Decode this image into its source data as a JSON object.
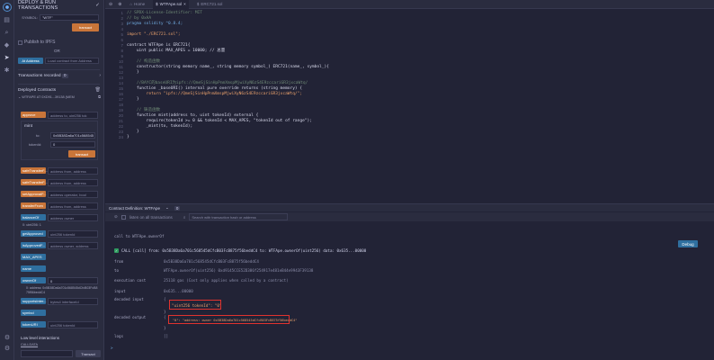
{
  "panel": {
    "title": "DEPLOY & RUN TRANSACTIONS",
    "symbol_label": "SYMBOL:",
    "symbol_value": "\"WTF\"",
    "transact": "transact",
    "publish_ipfs": "Publish to IPFS",
    "or_label": "OR",
    "at_address": "At Address",
    "load_contract_placeholder": "Load contract from Address",
    "transactions_recorded": "Transactions recorded",
    "transactions_count": "0",
    "deployed_contracts": "Deployed Contracts",
    "deployed_item": "WTFAPE AT 0XD91...39138 (MEM",
    "mint_label": "mint",
    "mint_to_label": "to:",
    "mint_to_value": "0x5B38Da6a701c568545",
    "mint_token_label": "tokenId:",
    "mint_token_value": "0",
    "functions": [
      {
        "label": "approve",
        "placeholder": "address to, uint256 tok",
        "color": "orange"
      },
      {
        "label": "safeTransferF...",
        "placeholder": "address from, address",
        "color": "orange"
      },
      {
        "label": "safeTransferF...",
        "placeholder": "address from, address",
        "color": "orange"
      },
      {
        "label": "setApprovalF...",
        "placeholder": "address operator, bool",
        "color": "orange"
      },
      {
        "label": "transferFrom",
        "placeholder": "address from, address",
        "color": "orange"
      },
      {
        "label": "balanceOf",
        "placeholder": "address owner",
        "color": "blue"
      },
      {
        "label": "getApproved",
        "placeholder": "uint256 tokenId",
        "color": "blue"
      },
      {
        "label": "isApprovedF...",
        "placeholder": "address owner, address",
        "color": "blue"
      },
      {
        "label": "MAX_APES",
        "placeholder": "",
        "color": "blue"
      },
      {
        "label": "name",
        "placeholder": "",
        "color": "blue"
      },
      {
        "label": "ownerOf",
        "placeholder": "0",
        "color": "blue"
      },
      {
        "label": "supportsInter...",
        "placeholder": "bytes4 interfaceId",
        "color": "blue"
      },
      {
        "label": "symbol",
        "placeholder": "",
        "color": "blue"
      },
      {
        "label": "tokenURI",
        "placeholder": "uint256 tokenId",
        "color": "blue"
      }
    ],
    "balance_result": "0: uint256: 1",
    "owner_result": "0: address: 0x5B38Da6a701c568545dCfcB03FcB875f56beddC4",
    "low_level": "Low level interactions",
    "calldata_label": "CALLDATA",
    "transact_btn": "Transact"
  },
  "tabs": [
    {
      "label": "Home",
      "active": false
    },
    {
      "label": "WTFApe.sol",
      "active": true
    },
    {
      "label": "ERC721.sol",
      "active": false
    }
  ],
  "code_lines": [
    {
      "n": "1",
      "t": "// SPDX-License-Identifier: MIT",
      "c": "c-com"
    },
    {
      "n": "2",
      "t": "// by 0xAA",
      "c": "c-com"
    },
    {
      "n": "3",
      "t": "pragma solidity ^0.8.4;",
      "c": "c-kw"
    },
    {
      "n": "4",
      "t": "",
      "c": ""
    },
    {
      "n": "5",
      "t": "import \"./ERC721.sol\";",
      "c": "c-str"
    },
    {
      "n": "6",
      "t": "",
      "c": ""
    },
    {
      "n": "7",
      "t": "contract WTFApe is ERC721{",
      "c": ""
    },
    {
      "n": "8",
      "t": "    uint public MAX_APES = 10000; // 总量",
      "c": ""
    },
    {
      "n": "9",
      "t": "",
      "c": ""
    },
    {
      "n": "10",
      "t": "    // 构造函数",
      "c": "c-com"
    },
    {
      "n": "11",
      "t": "    constructor(string memory name_, string memory symbol_) ERC721(name_, symbol_){",
      "c": ""
    },
    {
      "n": "12",
      "t": "    }",
      "c": ""
    },
    {
      "n": "13",
      "t": "",
      "c": ""
    },
    {
      "n": "14",
      "t": "    //BAYC的baseURI为ipfs://QmeSjSinHpPnmXmspMjwiXyN6zS4E9zccariGR3jxcaWtq/",
      "c": "c-com"
    },
    {
      "n": "15",
      "t": "    function _baseURI() internal pure override returns (string memory) {",
      "c": ""
    },
    {
      "n": "16",
      "t": "        return \"ipfs://QmeSjSinHpPnmXmspMjwiXyN6zS4E9zccariGR3jxcaWtq/\";",
      "c": "c-str"
    },
    {
      "n": "17",
      "t": "    }",
      "c": ""
    },
    {
      "n": "18",
      "t": "",
      "c": ""
    },
    {
      "n": "19",
      "t": "    // 铸造函数",
      "c": "c-com"
    },
    {
      "n": "20",
      "t": "    function mint(address to, uint tokenId) external {",
      "c": ""
    },
    {
      "n": "21",
      "t": "        require(tokenId >= 0 && tokenId < MAX_APES, \"tokenId out of range\");",
      "c": ""
    },
    {
      "n": "22",
      "t": "        _mint(to, tokenId);",
      "c": ""
    },
    {
      "n": "23",
      "t": "    }",
      "c": ""
    },
    {
      "n": "24",
      "t": "}",
      "c": ""
    }
  ],
  "terminal": {
    "bar_label": "Contract Definition: WTFApe",
    "listen_count": "0",
    "listen_label": "listen on all transactions",
    "search_placeholder": "Search with transaction hash or address",
    "call_line": "call to WTFApe.ownerOf",
    "call_header": "CALL  [call] from: 0x5B38Da6a701c568545dCfcB03FcB875f56beddC4 to: WTFApe.ownerOf(uint256) data: 0x635...00000",
    "debug": "Debug",
    "rows": [
      {
        "k": "from",
        "v": "0x5B38Da6a701c568545dCfcB03FcB875f56beddC4"
      },
      {
        "k": "to",
        "v": "WTFApe.ownerOf(uint256) 0xd9145CCE52D386f254917e481eB44e9943F39138"
      },
      {
        "k": "execution cost",
        "v": "25118 gas (Cost only applies when called by a contract)"
      },
      {
        "k": "input",
        "v": "0x635...00000"
      },
      {
        "k": "decoded input",
        "v": "{"
      },
      {
        "k": "decoded output",
        "v": "{"
      },
      {
        "k": "logs",
        "v": "[]"
      }
    ],
    "decoded_input_value": "\"uint256 tokenId\": \"0\"",
    "decoded_output_value": "\"0\": \"address: owner 0x5B38Da6a701c568545dCfcB03FcB875f56beddC4\""
  }
}
